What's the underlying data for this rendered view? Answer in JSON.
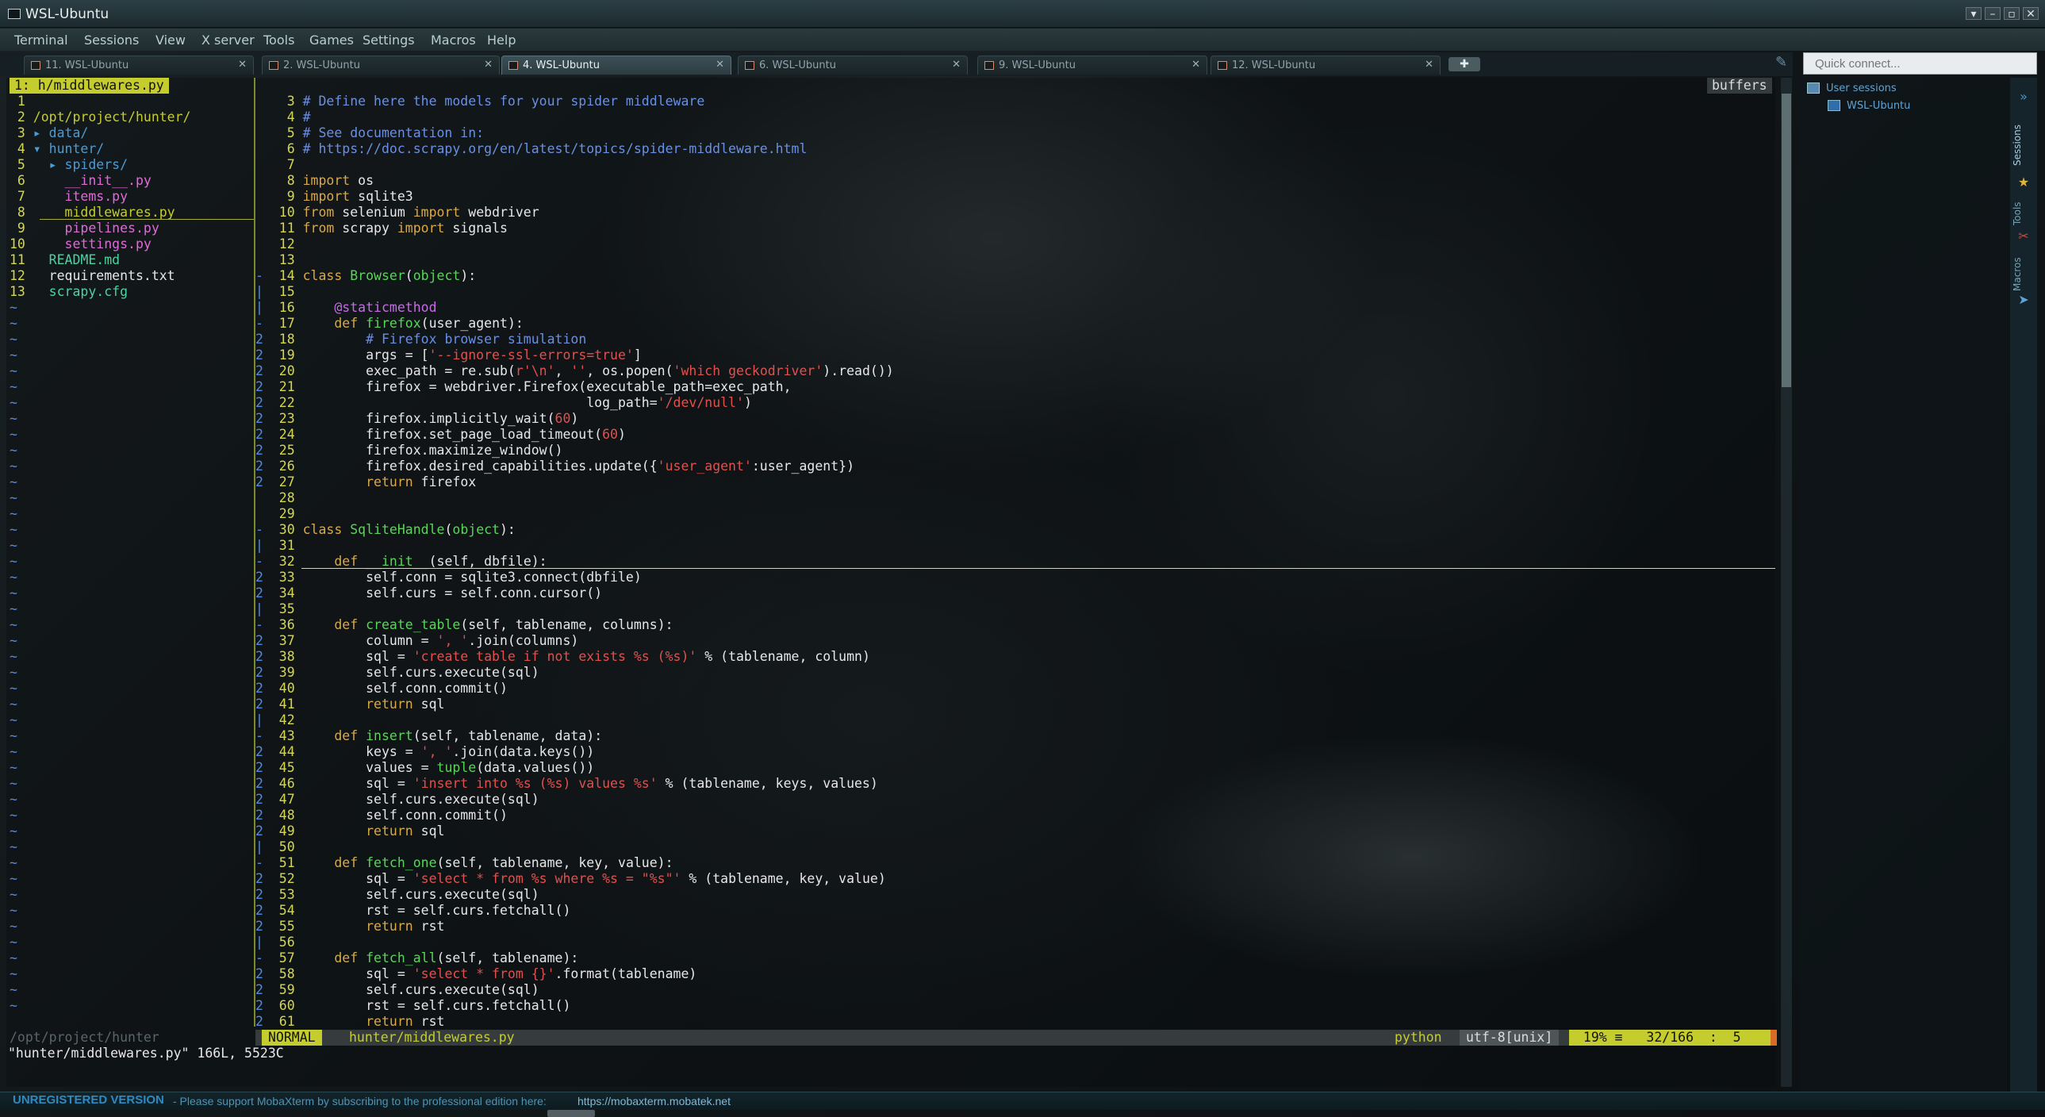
{
  "window": {
    "title": "WSL-Ubuntu"
  },
  "menu": [
    "Terminal",
    "Sessions",
    "View",
    "X server",
    "Tools",
    "Games",
    "Settings",
    "Macros",
    "Help"
  ],
  "tabs": [
    {
      "label": "11. WSL-Ubuntu",
      "active": false
    },
    {
      "label": "2. WSL-Ubuntu",
      "active": false
    },
    {
      "label": "4. WSL-Ubuntu",
      "active": true
    },
    {
      "label": "6. WSL-Ubuntu",
      "active": false
    },
    {
      "label": "9. WSL-Ubuntu",
      "active": false
    },
    {
      "label": "12. WSL-Ubuntu",
      "active": false
    }
  ],
  "quick_connect": {
    "placeholder": "Quick connect..."
  },
  "sessions": {
    "root": "User sessions",
    "item": "WSL-Ubuntu"
  },
  "side_tabs": [
    "Sessions",
    "Tools",
    "Macros"
  ],
  "vim": {
    "tree_header": "1: h/middlewares.py",
    "buffers_label": "buffers",
    "tree": [
      {
        "n": "1",
        "text": ""
      },
      {
        "n": "2",
        "text": "/opt/project/hunter/",
        "kind": "dir"
      },
      {
        "n": "3",
        "text": "▸ data/",
        "kind": "folder"
      },
      {
        "n": "4",
        "text": "▾ hunter/",
        "kind": "folder"
      },
      {
        "n": "5",
        "text": "  ▸ spiders/",
        "kind": "folder"
      },
      {
        "n": "6",
        "text": "    __init__.py",
        "kind": "py"
      },
      {
        "n": "7",
        "text": "    items.py",
        "kind": "py"
      },
      {
        "n": "8",
        "text": "    middlewares.py",
        "kind": "py",
        "hl": true
      },
      {
        "n": "9",
        "text": "    pipelines.py",
        "kind": "py"
      },
      {
        "n": "10",
        "text": "    settings.py",
        "kind": "py"
      },
      {
        "n": "11",
        "text": "  README.md",
        "kind": "name"
      },
      {
        "n": "12",
        "text": "  requirements.txt",
        "kind": "file"
      },
      {
        "n": "13",
        "text": "  scrapy.cfg",
        "kind": "name"
      }
    ],
    "tree_path": "/opt/project/hunter",
    "code": [
      {
        "n": "3",
        "f": "",
        "html": "<span class='c-cm'># Define here the models for your spider middleware</span>"
      },
      {
        "n": "4",
        "f": "",
        "html": "<span class='c-cm'>#</span>"
      },
      {
        "n": "5",
        "f": "",
        "html": "<span class='c-cm'># See documentation in:</span>"
      },
      {
        "n": "6",
        "f": "",
        "html": "<span class='c-cm'># https://doc.scrapy.org/en/latest/topics/spider-middleware.html</span>"
      },
      {
        "n": "7",
        "f": "",
        "html": ""
      },
      {
        "n": "8",
        "f": "",
        "html": "<span class='c-kw'>import</span> os"
      },
      {
        "n": "9",
        "f": "",
        "html": "<span class='c-kw'>import</span> sqlite3"
      },
      {
        "n": "10",
        "f": "",
        "html": "<span class='c-kw'>from</span> selenium <span class='c-kw'>import</span> webdriver"
      },
      {
        "n": "11",
        "f": "",
        "html": "<span class='c-kw'>from</span> scrapy <span class='c-kw'>import</span> signals"
      },
      {
        "n": "12",
        "f": "",
        "html": ""
      },
      {
        "n": "13",
        "f": "",
        "html": ""
      },
      {
        "n": "14",
        "f": "-",
        "html": "<span class='c-kw'>class</span> <span class='c-fn'>Browser</span>(<span class='c-fn'>object</span>):"
      },
      {
        "n": "15",
        "f": "|",
        "html": ""
      },
      {
        "n": "16",
        "f": "|",
        "html": "    <span class='c-dec'>@staticmethod</span>"
      },
      {
        "n": "17",
        "f": "-",
        "html": "    <span class='c-kw'>def</span> <span class='c-fn'>firefox</span>(user_agent):"
      },
      {
        "n": "18",
        "f": "2",
        "html": "        <span class='c-cm'># Firefox browser simulation</span>"
      },
      {
        "n": "19",
        "f": "2",
        "html": "        args = [<span class='c-st'>'--ignore-ssl-errors=true'</span>]"
      },
      {
        "n": "20",
        "f": "2",
        "html": "        exec_path = re.sub(<span class='c-st'>r'\\n'</span>, <span class='c-st'>''</span>, os.popen(<span class='c-st'>'which geckodriver'</span>).read())"
      },
      {
        "n": "21",
        "f": "2",
        "html": "        firefox = webdriver.Firefox(executable_path=exec_path,"
      },
      {
        "n": "22",
        "f": "2",
        "html": "                                    log_path=<span class='c-st'>'/dev/null'</span>)"
      },
      {
        "n": "23",
        "f": "2",
        "html": "        firefox.implicitly_wait(<span class='c-num'>60</span>)"
      },
      {
        "n": "24",
        "f": "2",
        "html": "        firefox.set_page_load_timeout(<span class='c-num'>60</span>)"
      },
      {
        "n": "25",
        "f": "2",
        "html": "        firefox.maximize_window()"
      },
      {
        "n": "26",
        "f": "2",
        "html": "        firefox.desired_capabilities.update({<span class='c-st'>'user_agent'</span>:user_agent})"
      },
      {
        "n": "27",
        "f": "2",
        "html": "        <span class='c-kw'>return</span> firefox"
      },
      {
        "n": "28",
        "f": "",
        "html": ""
      },
      {
        "n": "29",
        "f": "",
        "html": ""
      },
      {
        "n": "30",
        "f": "-",
        "html": "<span class='c-kw'>class</span> <span class='c-fn'>SqliteHandle</span>(<span class='c-fn'>object</span>):"
      },
      {
        "n": "31",
        "f": "|",
        "html": ""
      },
      {
        "n": "32",
        "f": "-",
        "html": "    <span class='c-kw'>def</span> <span class='c-fn'>__init__</span>(self, dbfile):"
      },
      {
        "n": "33",
        "f": "2",
        "html": "        self.conn = sqlite3.connect(dbfile)"
      },
      {
        "n": "34",
        "f": "2",
        "html": "        self.curs = self.conn.cursor()"
      },
      {
        "n": "35",
        "f": "|",
        "html": ""
      },
      {
        "n": "36",
        "f": "-",
        "html": "    <span class='c-kw'>def</span> <span class='c-fn'>create_table</span>(self, tablename, columns):"
      },
      {
        "n": "37",
        "f": "2",
        "html": "        column = <span class='c-st'>', '</span>.join(columns)"
      },
      {
        "n": "38",
        "f": "2",
        "html": "        sql = <span class='c-st'>'create table if not exists %s (%s)'</span> % (tablename, column)"
      },
      {
        "n": "39",
        "f": "2",
        "html": "        self.curs.execute(sql)"
      },
      {
        "n": "40",
        "f": "2",
        "html": "        self.conn.commit()"
      },
      {
        "n": "41",
        "f": "2",
        "html": "        <span class='c-kw'>return</span> sql"
      },
      {
        "n": "42",
        "f": "|",
        "html": ""
      },
      {
        "n": "43",
        "f": "-",
        "html": "    <span class='c-kw'>def</span> <span class='c-fn'>insert</span>(self, tablename, data):"
      },
      {
        "n": "44",
        "f": "2",
        "html": "        keys = <span class='c-st'>', '</span>.join(data.keys())"
      },
      {
        "n": "45",
        "f": "2",
        "html": "        values = <span class='c-fn'>tuple</span>(data.values())"
      },
      {
        "n": "46",
        "f": "2",
        "html": "        sql = <span class='c-st'>'insert into %s (%s) values %s'</span> % (tablename, keys, values)"
      },
      {
        "n": "47",
        "f": "2",
        "html": "        self.curs.execute(sql)"
      },
      {
        "n": "48",
        "f": "2",
        "html": "        self.conn.commit()"
      },
      {
        "n": "49",
        "f": "2",
        "html": "        <span class='c-kw'>return</span> sql"
      },
      {
        "n": "50",
        "f": "|",
        "html": ""
      },
      {
        "n": "51",
        "f": "-",
        "html": "    <span class='c-kw'>def</span> <span class='c-fn'>fetch_one</span>(self, tablename, key, value):"
      },
      {
        "n": "52",
        "f": "2",
        "html": "        sql = <span class='c-st'>'select * from %s where %s = \"%s\"'</span> % (tablename, key, value)"
      },
      {
        "n": "53",
        "f": "2",
        "html": "        self.curs.execute(sql)"
      },
      {
        "n": "54",
        "f": "2",
        "html": "        rst = self.curs.fetchall()"
      },
      {
        "n": "55",
        "f": "2",
        "html": "        <span class='c-kw'>return</span> rst"
      },
      {
        "n": "56",
        "f": "|",
        "html": ""
      },
      {
        "n": "57",
        "f": "-",
        "html": "    <span class='c-kw'>def</span> <span class='c-fn'>fetch_all</span>(self, tablename):"
      },
      {
        "n": "58",
        "f": "2",
        "html": "        sql = <span class='c-st'>'select * from {}'</span>.format(tablename)"
      },
      {
        "n": "59",
        "f": "2",
        "html": "        self.curs.execute(sql)"
      },
      {
        "n": "60",
        "f": "2",
        "html": "        rst = self.curs.fetchall()"
      },
      {
        "n": "61",
        "f": "2",
        "html": "        <span class='c-kw'>return</span> rst"
      }
    ],
    "status": {
      "mode": "NORMAL",
      "file": "hunter/middlewares.py",
      "filetype": "python",
      "encoding": "utf-8[unix]",
      "position": " 19% ≡   32/166  :  5 "
    },
    "cmdline": "\"hunter/middlewares.py\" 166L, 5523C"
  },
  "footer": {
    "unregistered": "UNREGISTERED VERSION",
    "support": "-  Please support MobaXterm by subscribing to the professional edition here:",
    "link": "https://mobaxterm.mobatek.net"
  },
  "colors": {
    "accent": "#c5cd2e",
    "keyword": "#d8a94a",
    "string": "#e0514e",
    "comment": "#6a8fe3",
    "function": "#5cd35c"
  }
}
